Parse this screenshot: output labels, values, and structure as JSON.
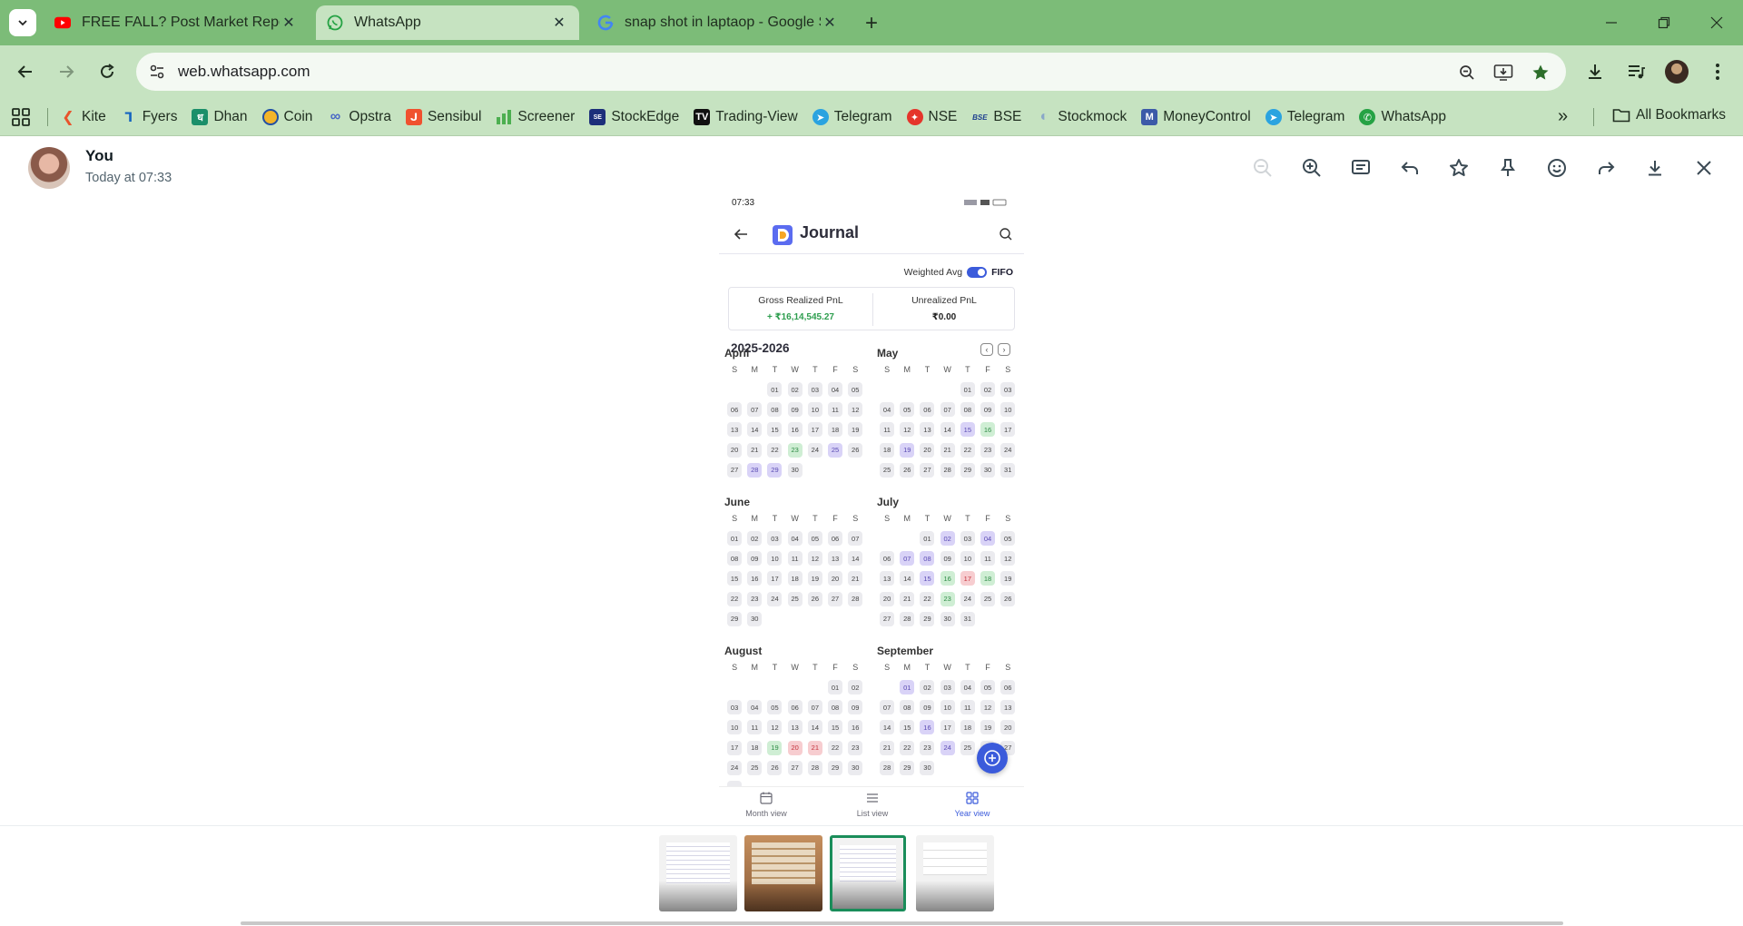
{
  "browser": {
    "tabs": [
      {
        "title": "FREE FALL? Post Market Report",
        "icon": "youtube-icon",
        "active": false
      },
      {
        "title": "WhatsApp",
        "icon": "whatsapp-icon",
        "active": true
      },
      {
        "title": "snap shot in laptaop - Google S",
        "icon": "google-icon",
        "active": false
      }
    ],
    "url": "web.whatsapp.com",
    "bookmarks": [
      "Kite",
      "Fyers",
      "Dhan",
      "Coin",
      "Opstra",
      "Sensibul",
      "Screener",
      "StockEdge",
      "Trading-View",
      "Telegram",
      "NSE",
      "BSE",
      "Stockmock",
      "MoneyControl",
      "Telegram",
      "WhatsApp"
    ],
    "all_bookmarks": "All Bookmarks",
    "colors": {
      "frame": "#7cbc78",
      "toolbar": "#c6e3c1"
    }
  },
  "viewer": {
    "sender": "You",
    "time": "Today at 07:33"
  },
  "screenshot": {
    "status_time": "07:33",
    "app_title": "Journal",
    "toggle_left": "Weighted Avg",
    "toggle_right": "FIFO",
    "gross_label": "Gross Realized PnL",
    "gross_value": "+ ₹16,14,545.27",
    "unrealized_label": "Unrealized PnL",
    "unrealized_value": "₹0.00",
    "year_label": "2025-2026",
    "weekdays": [
      "S",
      "M",
      "T",
      "W",
      "T",
      "F",
      "S"
    ],
    "months": [
      {
        "name": "April",
        "offset": 2,
        "days": 30,
        "purple": [
          25,
          28,
          29
        ],
        "green": [
          23
        ],
        "red": []
      },
      {
        "name": "May",
        "offset": 4,
        "days": 31,
        "purple": [
          15,
          19
        ],
        "green": [
          16
        ],
        "red": []
      },
      {
        "name": "June",
        "offset": 0,
        "days": 30,
        "purple": [],
        "green": [],
        "red": []
      },
      {
        "name": "July",
        "offset": 2,
        "days": 31,
        "purple": [
          2,
          4,
          7,
          8,
          15
        ],
        "green": [
          16,
          18,
          23
        ],
        "red": [
          17
        ]
      },
      {
        "name": "August",
        "offset": 5,
        "days": 31,
        "purple": [],
        "green": [
          19
        ],
        "red": [
          20,
          21
        ]
      },
      {
        "name": "September",
        "offset": 1,
        "days": 30,
        "purple": [
          1,
          16,
          24
        ],
        "green": [],
        "red": []
      }
    ],
    "bottom_nav": [
      "Month view",
      "List view",
      "Year view"
    ],
    "active_view": "Year view",
    "colors": {
      "accent": "#3b5bdb",
      "profit": "#2e9e4f",
      "loss": "#c4323c",
      "trade_day": "#d9d3f7"
    }
  },
  "thumbnails": {
    "count": 4,
    "selected": 3
  }
}
